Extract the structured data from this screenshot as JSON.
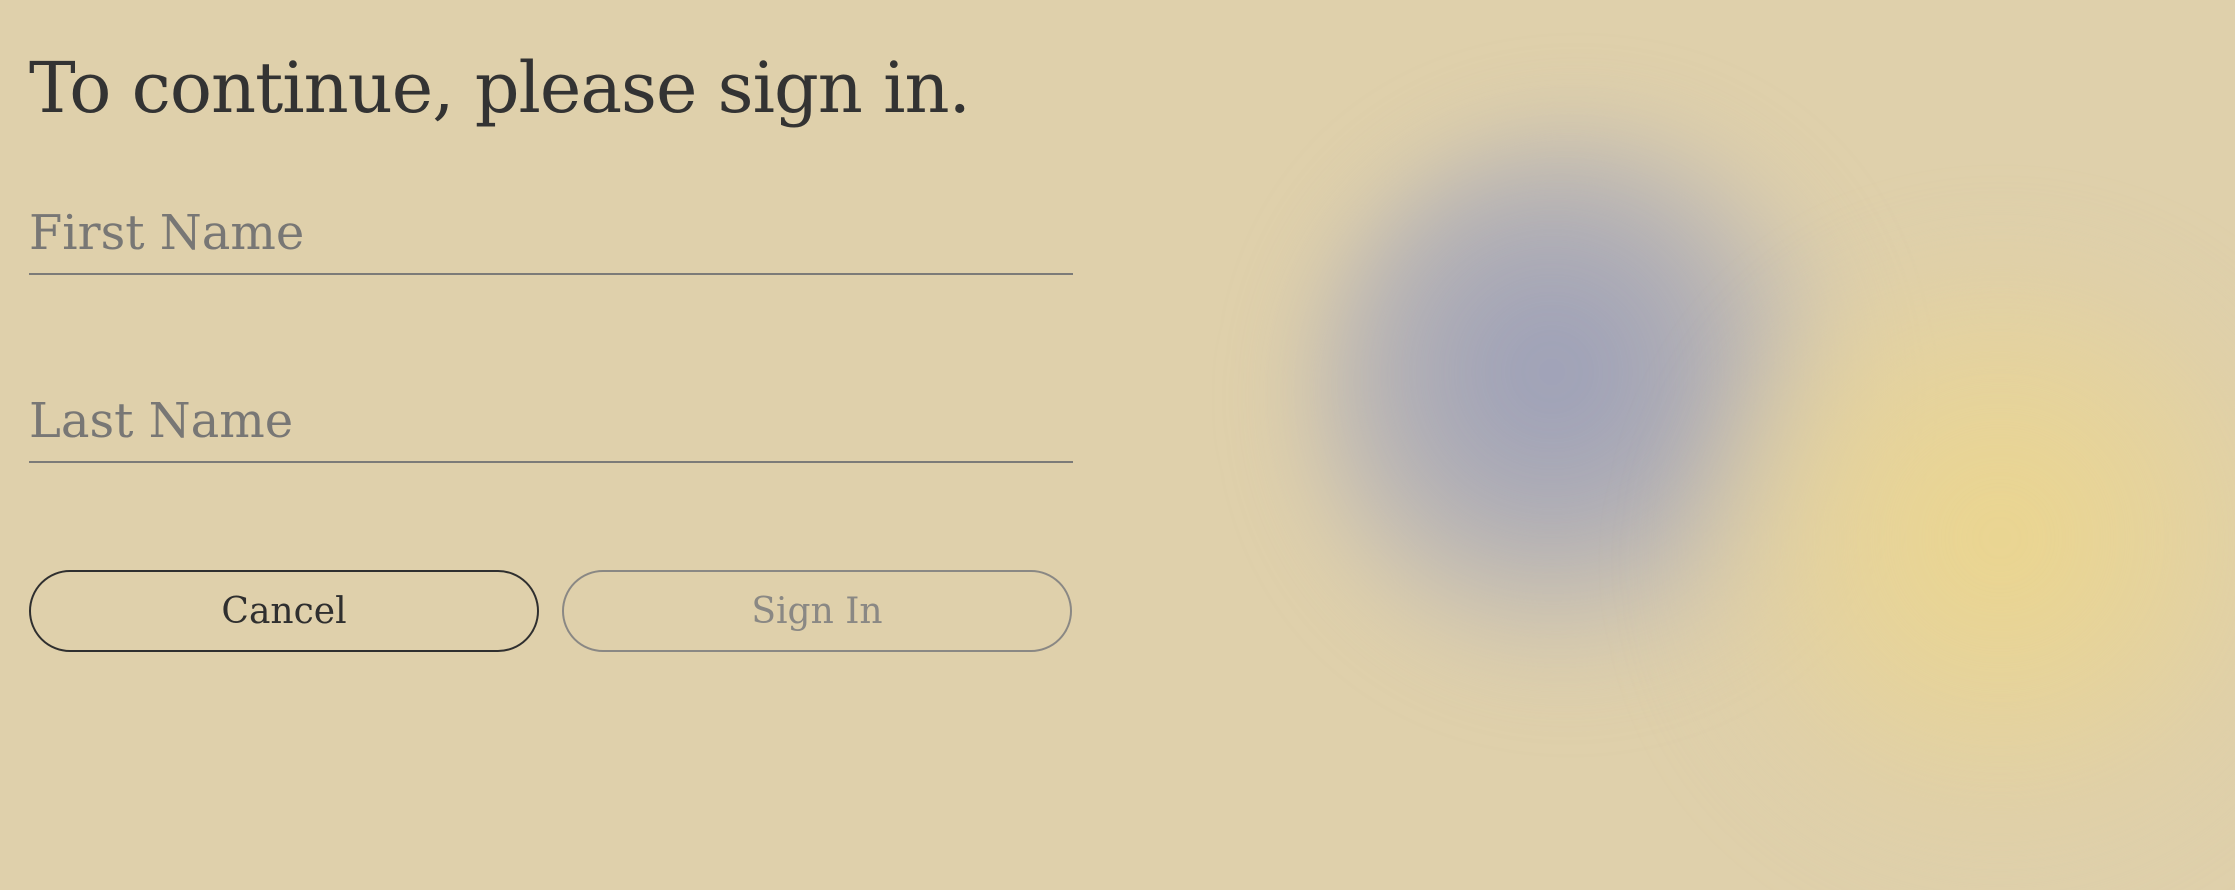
{
  "page": {
    "title": "To continue, please sign in."
  },
  "form": {
    "first_name": {
      "placeholder": "First Name",
      "value": ""
    },
    "last_name": {
      "placeholder": "Last Name",
      "value": ""
    }
  },
  "actions": {
    "cancel_label": "Cancel",
    "sign_in_label": "Sign In",
    "sign_in_enabled": false
  },
  "colors": {
    "background": "#dfd0ab",
    "text": "#333333",
    "placeholder": "#787775",
    "disabled": "#8a8884",
    "blob_blue": "#9a9cb6",
    "blob_yellow": "#ecd68c"
  }
}
